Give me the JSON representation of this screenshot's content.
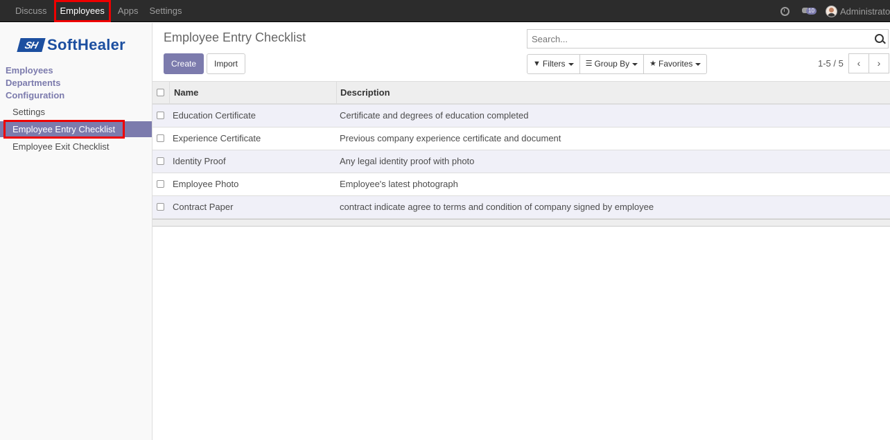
{
  "topbar": {
    "menu": [
      "Discuss",
      "Employees",
      "Apps",
      "Settings"
    ],
    "active_menu": "Employees",
    "chat_badge": "10",
    "user": "Administrator"
  },
  "sidebar": {
    "logo_mark": "SH",
    "logo_text": "SoftHealer",
    "sections": [
      "Employees",
      "Departments",
      "Configuration"
    ],
    "config_items": [
      "Settings",
      "Employee Entry Checklist",
      "Employee Exit Checklist"
    ],
    "active_item": "Employee Entry Checklist"
  },
  "main": {
    "title": "Employee Entry Checklist",
    "create_label": "Create",
    "import_label": "Import",
    "search_placeholder": "Search...",
    "filters_label": "Filters",
    "groupby_label": "Group By",
    "favorites_label": "Favorites",
    "pager": "1-5 / 5",
    "pager_prev": "‹",
    "pager_next": "›",
    "columns": [
      "Name",
      "Description"
    ],
    "rows": [
      {
        "name": "Education Certificate",
        "description": "Certificate and degrees of education completed"
      },
      {
        "name": "Experience Certificate",
        "description": "Previous company experience certificate and document"
      },
      {
        "name": "Identity Proof",
        "description": "Any legal identity proof with photo"
      },
      {
        "name": "Employee Photo",
        "description": "Employee's latest photograph"
      },
      {
        "name": "Contract Paper",
        "description": "contract indicate agree to terms and condition of company signed by employee"
      }
    ]
  },
  "colors": {
    "accent": "#7c7bad",
    "highlight": "#e00000",
    "topbar_bg": "#2c2c2c",
    "logo": "#1c4fa0"
  },
  "icons": [
    "clock-icon",
    "chat-icon",
    "avatar",
    "search-icon",
    "filter-icon",
    "list-icon",
    "star-icon",
    "chevron-left-icon",
    "chevron-right-icon"
  ]
}
